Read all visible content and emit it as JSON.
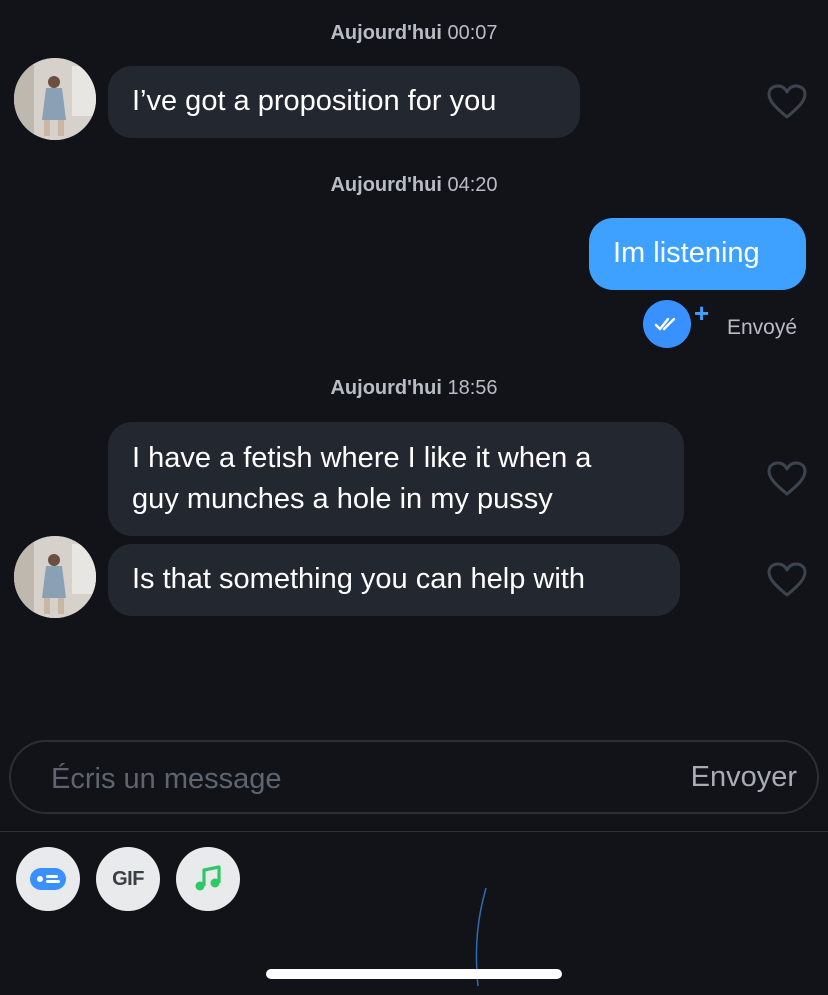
{
  "messages": [
    {
      "timestamp_day": "Aujourd'hui",
      "timestamp_time": "00:07",
      "text": "I’ve got a proposition for you"
    },
    {
      "timestamp_day": "Aujourd'hui",
      "timestamp_time": "04:20",
      "text": "Im listening",
      "status": "Envoyé"
    },
    {
      "timestamp_day": "Aujourd'hui",
      "timestamp_time": "18:56",
      "text_line1": "I have a fetish where I like it when a",
      "text_line2": "guy munches a hole in my pussy",
      "text2": "Is that something you can help with"
    }
  ],
  "composer": {
    "placeholder": "Écris un message",
    "send_label": "Envoyer"
  },
  "toolbar": {
    "gif_label": "GIF"
  },
  "colors": {
    "background": "#111318",
    "incoming_bubble": "#232830",
    "outgoing_bubble": "#3ea1ff",
    "accent": "#3891ff"
  }
}
